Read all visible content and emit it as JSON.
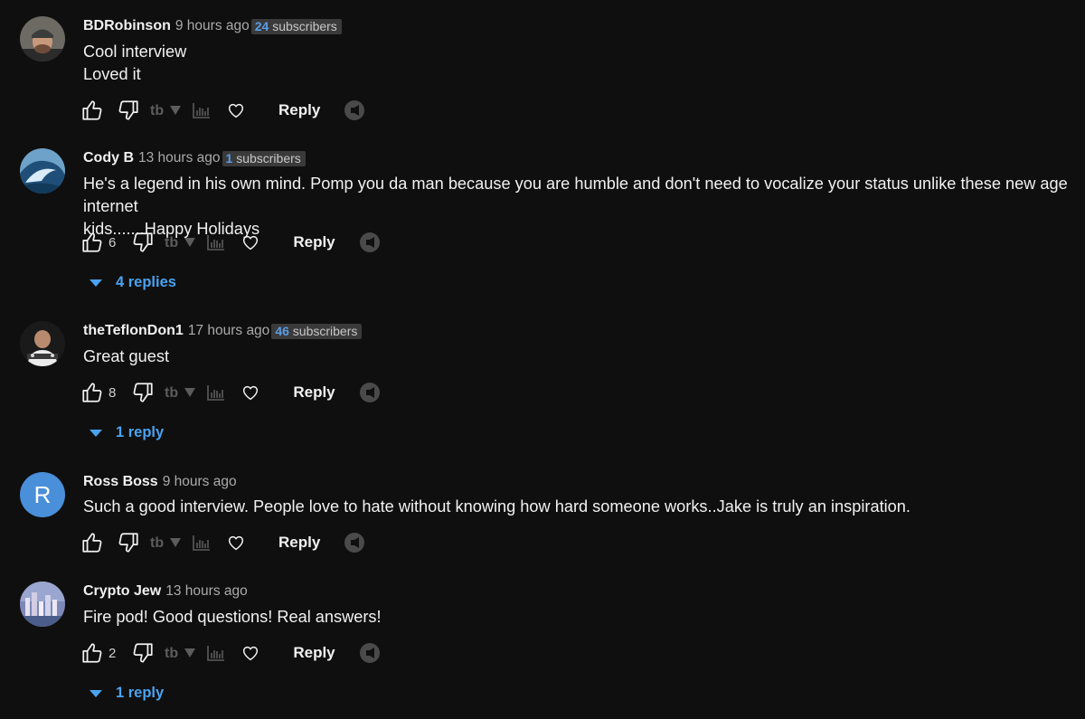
{
  "colors": {
    "background": "#0f0f0f",
    "link_blue": "#4aa3f0",
    "badge_bg": "#3a3a3a"
  },
  "icons": [
    "thumb-up-icon",
    "thumb-down-icon",
    "tubebuddy-icon",
    "analytics-icon",
    "heart-icon",
    "promote-icon",
    "chevron-down-icon"
  ],
  "comments": [
    {
      "author": "BDRobinson",
      "time": "9 hours ago",
      "badge_count": "24",
      "badge_label": "subscribers",
      "lines": [
        "Cool interview",
        "Loved it"
      ],
      "likes": "",
      "reply_label": "Reply",
      "replies_label": ""
    },
    {
      "author": "Cody B",
      "time": "13 hours ago",
      "badge_count": "1",
      "badge_label": "subscribers",
      "lines": [
        "He's a legend in his own mind. Pomp you da man because you are humble and don't need to vocalize your status unlike these new age internet",
        "kids.......Happy Holidays"
      ],
      "likes": "6",
      "reply_label": "Reply",
      "replies_label": "4 replies"
    },
    {
      "author": "theTeflonDon1",
      "time": "17 hours ago",
      "badge_count": "46",
      "badge_label": "subscribers",
      "lines": [
        "Great guest"
      ],
      "likes": "8",
      "reply_label": "Reply",
      "replies_label": "1 reply"
    },
    {
      "author": "Ross Boss",
      "time": "9 hours ago",
      "avatar_letter": "R",
      "lines": [
        "Such a good interview. People love to hate without knowing how hard someone works..Jake is truly an inspiration."
      ],
      "likes": "",
      "reply_label": "Reply",
      "replies_label": ""
    },
    {
      "author": "Crypto Jew",
      "time": "13 hours ago",
      "lines": [
        "Fire pod! Good questions! Real answers!"
      ],
      "likes": "2",
      "reply_label": "Reply",
      "replies_label": "1 reply"
    }
  ]
}
